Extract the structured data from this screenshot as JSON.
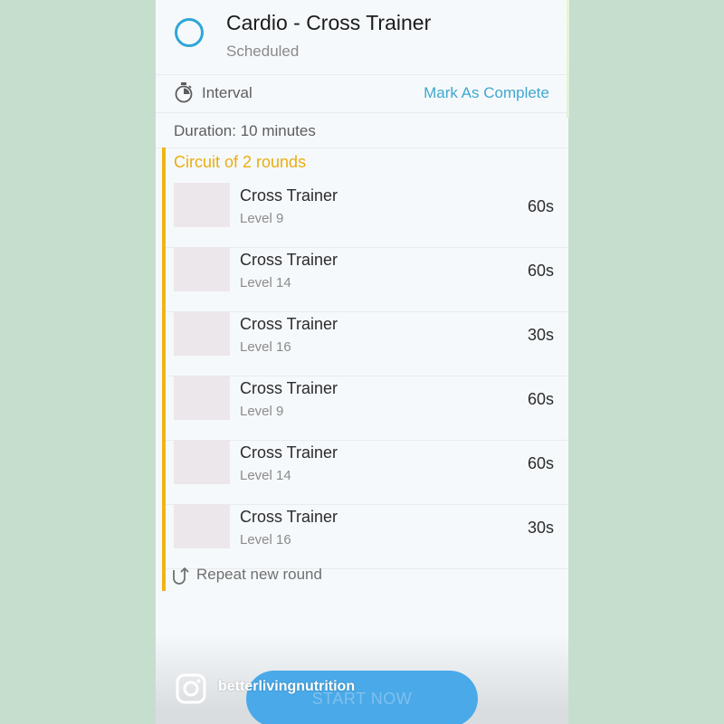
{
  "workout": {
    "title": "Cardio - Cross Trainer",
    "status": "Scheduled",
    "type_label": "Interval",
    "mark_complete_label": "Mark As Complete",
    "duration": "Duration: 10 minutes"
  },
  "circuit": {
    "label": "Circuit of 2 rounds",
    "exercises": [
      {
        "name": "Cross Trainer",
        "level": "Level 9",
        "time": "60s"
      },
      {
        "name": "Cross Trainer",
        "level": "Level 14",
        "time": "60s"
      },
      {
        "name": "Cross Trainer",
        "level": "Level 16",
        "time": "30s"
      },
      {
        "name": "Cross Trainer",
        "level": "Level 9",
        "time": "60s"
      },
      {
        "name": "Cross Trainer",
        "level": "Level 14",
        "time": "60s"
      },
      {
        "name": "Cross Trainer",
        "level": "Level 16",
        "time": "30s"
      }
    ],
    "repeat_label": "Repeat new round"
  },
  "footer": {
    "start_label": "START NOW",
    "instagram_handle": "betterlivingnutrition"
  },
  "colors": {
    "accent_blue": "#3fa7cf",
    "circuit_yellow": "#f0b41b",
    "button_blue": "#4aa9e8"
  },
  "icons": [
    "status-circle-icon",
    "timer-icon",
    "repeat-icon",
    "instagram-icon"
  ]
}
